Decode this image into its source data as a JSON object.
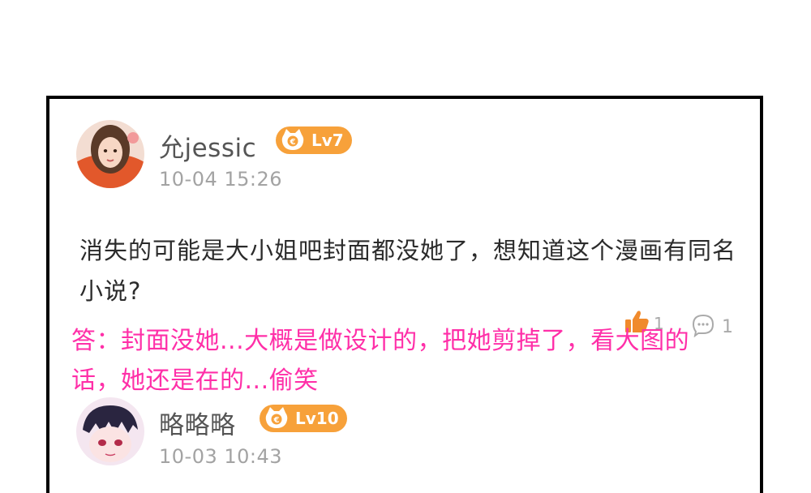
{
  "comments": [
    {
      "username": "允jessic",
      "level": "Lv7",
      "time": "10-04 15:26",
      "text": "消失的可能是大小姐吧封面都没她了，想知道这个漫画有同名小说?",
      "likes": "1",
      "replies": "1"
    },
    {
      "username": "略略略",
      "level": "Lv10",
      "time": "10-03 10:43"
    }
  ],
  "annotation": "答：封面没她...大概是做设计的，把她剪掉了，看大图的话，她还是在的...偷笑",
  "colors": {
    "badge": "#f7a13a",
    "annotation": "#ff2fa8",
    "like_icon": "#f08a2c",
    "meta_text": "#a3a3a3"
  },
  "icons": [
    "avatar",
    "cat-level-icon",
    "thumbs-up-icon",
    "comment-icon"
  ]
}
